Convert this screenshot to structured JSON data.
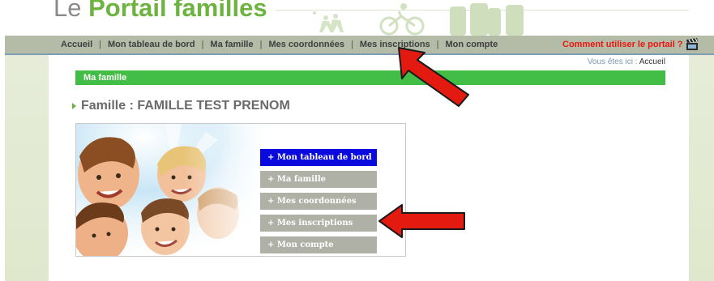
{
  "header": {
    "logo_prefix": "Le",
    "logo_main": "Portail familles"
  },
  "nav": {
    "items": [
      {
        "label": "Accueil"
      },
      {
        "label": "Mon tableau de bord"
      },
      {
        "label": "Ma famille"
      },
      {
        "label": "Mes coordonnées"
      },
      {
        "label": "Mes inscriptions"
      },
      {
        "label": "Mon compte"
      }
    ],
    "separator": "|",
    "help_label": "Comment utiliser le portail ?",
    "help_icon": "clapperboard-icon"
  },
  "breadcrumb": {
    "prefix": "Vous êtes ici :",
    "current": "Accueil"
  },
  "section": {
    "title": "Ma famille"
  },
  "page": {
    "title": "Famille : FAMILLE TEST PRENOM"
  },
  "menu": {
    "buttons": [
      {
        "label": "+ Mon tableau de bord",
        "state": "active"
      },
      {
        "label": "+ Ma famille",
        "state": "inactive"
      },
      {
        "label": "+ Mes coordonnées",
        "state": "inactive"
      },
      {
        "label": "+ Mes inscriptions",
        "state": "inactive"
      },
      {
        "label": "+ Mon compte",
        "state": "inactive"
      }
    ]
  },
  "colors": {
    "nav_bar": "#b4bba7",
    "section_green": "#42bd45",
    "active_button": "#0a0adf",
    "inactive_button": "#b0b1a6",
    "help_red": "#e8180e",
    "annotation_red": "#e21a10",
    "logo_green": "#6cb33f"
  },
  "annotations": [
    {
      "type": "arrow",
      "points_to": "Mes inscriptions (navigation)"
    },
    {
      "type": "arrow",
      "points_to": "+ Mes inscriptions (menu button)"
    }
  ]
}
